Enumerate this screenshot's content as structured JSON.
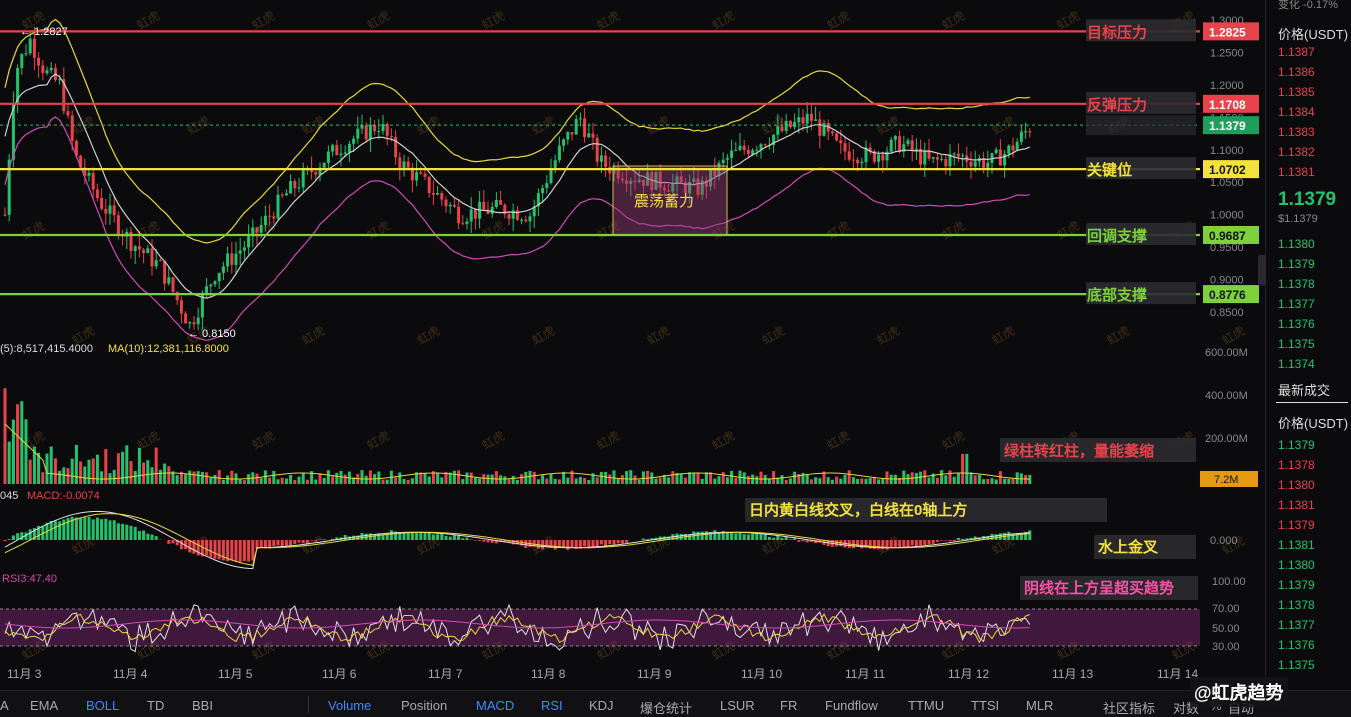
{
  "levels": [
    {
      "label": "目标压力",
      "value": "1.2825",
      "color": "#e8424a",
      "price": 1.2825
    },
    {
      "label": "反弹压力",
      "value": "1.1708",
      "color": "#e8424a",
      "price": 1.1708
    },
    {
      "label": "关键位",
      "value": "1.0702",
      "color": "#f4e23c",
      "price": 1.0702
    },
    {
      "label": "回调支撑",
      "value": "0.9687",
      "color": "#7ed13a",
      "price": 0.9687
    },
    {
      "label": "底部支撑",
      "value": "0.8776",
      "color": "#7ed13a",
      "price": 0.8776
    }
  ],
  "current_price_tag": "1.1379",
  "current_price": 1.1379,
  "price_ticks": [
    "1.3000",
    "1.2500",
    "1.2000",
    "1.1500",
    "1.1000",
    "1.0500",
    "1.0000",
    "0.9500",
    "0.9000",
    "0.8500"
  ],
  "price_tick_values": [
    1.3,
    1.25,
    1.2,
    1.15,
    1.1,
    1.05,
    1.0,
    0.95,
    0.9,
    0.85
  ],
  "high_marker": "← 1.2827",
  "low_marker": "← 0.8150",
  "box_label": "震荡蓄力",
  "volume": {
    "header_ma5": "(5):8,517,415.4000",
    "header_ma10": "MA(10):12,381,116.8000",
    "ticks": [
      "600.00M",
      "400.00M",
      "200.00M"
    ],
    "tag": "7.2M",
    "annotation": "绿柱转红柱，量能萎缩"
  },
  "macd": {
    "header_prefix": "045",
    "header_value": "MACD:-0.0074",
    "zero_tick": "0.000",
    "annotation1": "日内黄白线交叉，白线在0轴上方",
    "annotation2": "水上金叉"
  },
  "rsi": {
    "header": "RSI3:47.40",
    "ticks": [
      "100.00",
      "70.00",
      "50.00",
      "30.00"
    ],
    "annotation": "阴线在上方呈超买趋势"
  },
  "x_axis": [
    "11月 3",
    "11月 4",
    "11月 5",
    "11月 6",
    "11月 7",
    "11月 8",
    "11月 9",
    "11月 10",
    "11月 11",
    "11月 12",
    "11月 13",
    "11月 14"
  ],
  "watermark": "虹虎",
  "side": {
    "top_change": "变化    -0.17%",
    "price_header": "价格(USDT)",
    "ask_prices": [
      "1.1387",
      "1.1386",
      "1.1385",
      "1.1384",
      "1.1383",
      "1.1382",
      "1.1381"
    ],
    "last_price": "1.1379",
    "last_price_usd": "$1.1379",
    "bid_prices": [
      "1.1380",
      "1.1379",
      "1.1378",
      "1.1377",
      "1.1376",
      "1.1375",
      "1.1374"
    ],
    "trades_header": "最新成交",
    "trades_price_header": "价格(USDT)",
    "trades": [
      {
        "p": "1.1379",
        "c": "grn"
      },
      {
        "p": "1.1378",
        "c": "red"
      },
      {
        "p": "1.1380",
        "c": "red"
      },
      {
        "p": "1.1381",
        "c": "red"
      },
      {
        "p": "1.1379",
        "c": "red"
      },
      {
        "p": "1.1381",
        "c": "grn"
      },
      {
        "p": "1.1380",
        "c": "grn"
      },
      {
        "p": "1.1379",
        "c": "grn"
      },
      {
        "p": "1.1378",
        "c": "grn"
      },
      {
        "p": "1.1377",
        "c": "grn"
      },
      {
        "p": "1.1376",
        "c": "grn"
      },
      {
        "p": "1.1375",
        "c": "grn"
      }
    ]
  },
  "bottom_tabs": [
    {
      "label": "A"
    },
    {
      "label": "EMA"
    },
    {
      "label": "BOLL",
      "active": true
    },
    {
      "label": "TD"
    },
    {
      "label": "BBI"
    },
    {
      "label": "Volume",
      "active": true
    },
    {
      "label": "Position"
    },
    {
      "label": "MACD",
      "active": true
    },
    {
      "label": "RSI",
      "active": true
    },
    {
      "label": "KDJ"
    },
    {
      "label": "爆仓统计"
    },
    {
      "label": "LSUR"
    },
    {
      "label": "FR"
    },
    {
      "label": "Fundflow"
    },
    {
      "label": "TTMU"
    },
    {
      "label": "TTSI"
    },
    {
      "label": "MLR"
    }
  ],
  "bottom_extra": [
    "社区指标",
    "对数",
    "%",
    "自动"
  ],
  "brand": "@虹虎趋势"
}
